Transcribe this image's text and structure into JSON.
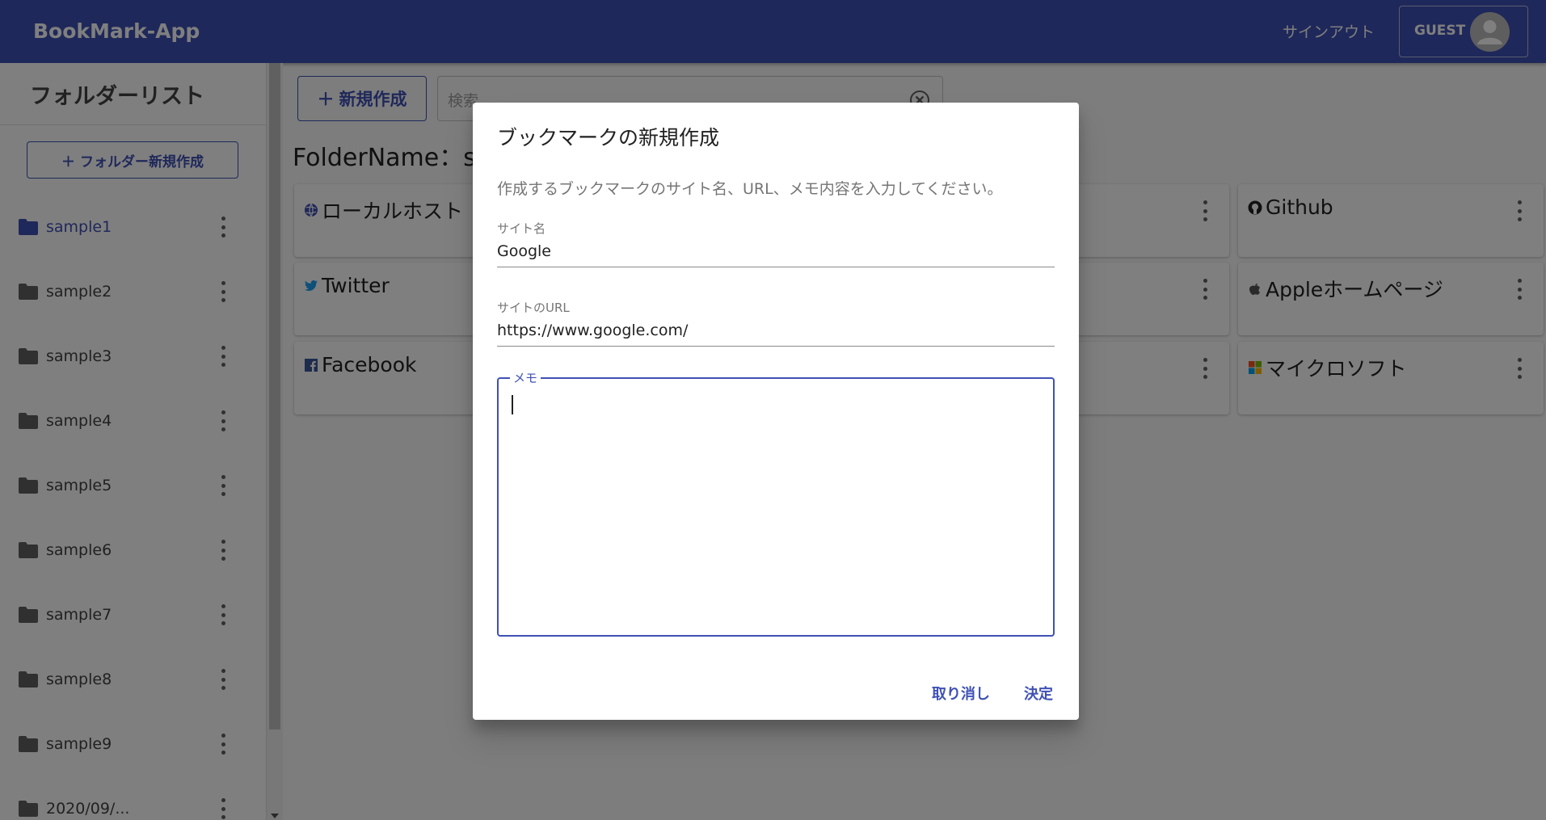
{
  "app": {
    "title": "BookMark-App",
    "signout_label": "サインアウト",
    "guest_label": "GUEST"
  },
  "sidebar": {
    "title": "フォルダーリスト",
    "new_folder_label": "フォルダー新規作成",
    "folders": [
      {
        "label": "sample1",
        "active": true
      },
      {
        "label": "sample2"
      },
      {
        "label": "sample3"
      },
      {
        "label": "sample4"
      },
      {
        "label": "sample5"
      },
      {
        "label": "sample6"
      },
      {
        "label": "sample7"
      },
      {
        "label": "sample8"
      },
      {
        "label": "sample9"
      },
      {
        "label": "2020/09/..."
      }
    ]
  },
  "main": {
    "new_bookmark_label": "新規作成",
    "search_placeholder": "検索",
    "folder_heading": "FolderName：sa",
    "cards": [
      {
        "label": "ローカルホスト",
        "icon": "globe-icon"
      },
      {
        "label": "Github",
        "icon": "github-icon"
      },
      {
        "label": "Twitter",
        "icon": "twitter-icon"
      },
      {
        "label": "Appleホームページ",
        "icon": "apple-icon"
      },
      {
        "label": "Facebook",
        "icon": "facebook-icon"
      },
      {
        "label": "マイクロソフト",
        "icon": "microsoft-icon"
      }
    ]
  },
  "dialog": {
    "title": "ブックマークの新規作成",
    "description": "作成するブックマークのサイト名、URL、メモ内容を入力してください。",
    "site_name_label": "サイト名",
    "site_name_value": "Google",
    "site_url_label": "サイトのURL",
    "site_url_value": "https://www.google.com/",
    "memo_label": "メモ",
    "memo_value": "",
    "cancel_label": "取り消し",
    "confirm_label": "決定"
  },
  "colors": {
    "primary": "#3f51b5",
    "overlay": "rgba(0,0,0,0.5)"
  }
}
